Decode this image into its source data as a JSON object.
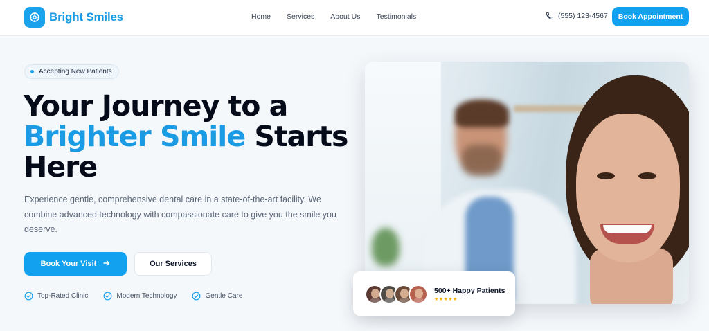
{
  "brand": {
    "name": "Bright Smiles",
    "accent": "#12a1ee",
    "logo_icon": "tooth-icon"
  },
  "nav": {
    "items": [
      {
        "label": "Home"
      },
      {
        "label": "Services"
      },
      {
        "label": "About Us"
      },
      {
        "label": "Testimonials"
      }
    ]
  },
  "header": {
    "phone": "(555) 123-4567",
    "phone_icon": "phone-icon",
    "cta_label": "Book Appointment"
  },
  "hero": {
    "badge": "Accepting New Patients",
    "headline_line1": "Your Journey to a",
    "headline_highlight": "Brighter Smile",
    "headline_after": "Starts",
    "headline_line3": "Here",
    "lead": "Experience gentle, comprehensive dental care in a state-of-the-art facility. We combine advanced technology with compassionate care to give you the smile you deserve.",
    "primary_button": "Book Your Visit",
    "primary_button_icon": "arrow-right-icon",
    "secondary_button": "Our Services",
    "features": [
      {
        "label": "Top-Rated Clinic",
        "icon": "check-circle-icon"
      },
      {
        "label": "Modern Technology",
        "icon": "check-circle-icon"
      },
      {
        "label": "Gentle Care",
        "icon": "check-circle-icon"
      }
    ]
  },
  "patients_card": {
    "title": "500+ Happy Patients",
    "stars": "★★★★★",
    "rating": 5,
    "avatar_colors": [
      "#5b3a33",
      "#4e4a46",
      "#6b4c3b",
      "#b8614f"
    ]
  }
}
